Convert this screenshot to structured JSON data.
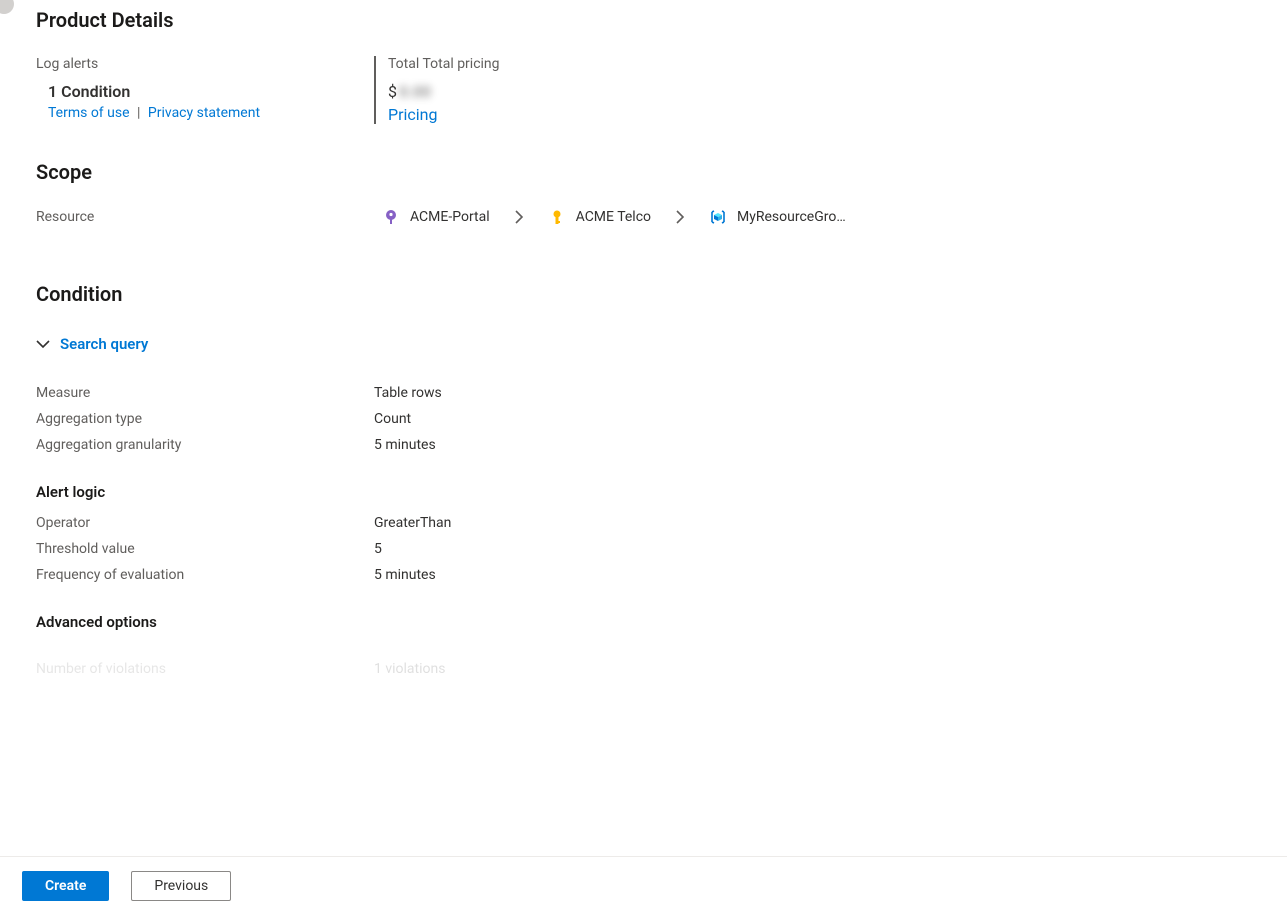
{
  "product": {
    "title": "Product Details",
    "left": {
      "label": "Log alerts",
      "condition_count": "1 Condition",
      "terms_link": "Terms of use",
      "privacy_link": "Privacy statement",
      "separator": "|"
    },
    "right": {
      "label": "Total Total pricing",
      "currency": "$",
      "blurred_value": "0.00",
      "pricing_link": "Pricing"
    }
  },
  "scope": {
    "title": "Scope",
    "label": "Resource",
    "crumbs": [
      "ACME-Portal",
      "ACME Telco",
      "MyResourceGro…"
    ]
  },
  "condition": {
    "title": "Condition",
    "search_query": "Search query",
    "rows": {
      "measure_key": "Measure",
      "measure_val": "Table rows",
      "aggtype_key": "Aggregation type",
      "aggtype_val": "Count",
      "agggran_key": "Aggregation granularity",
      "agggran_val": "5 minutes"
    },
    "alert_logic": {
      "title": "Alert logic",
      "operator_key": "Operator",
      "operator_val": "GreaterThan",
      "threshold_key": "Threshold value",
      "threshold_val": "5",
      "freq_key": "Frequency of evaluation",
      "freq_val": "5 minutes"
    },
    "advanced": {
      "title": "Advanced options",
      "numviol_key": "Number of violations",
      "numviol_val": "1 violations"
    }
  },
  "footer": {
    "create": "Create",
    "previous": "Previous"
  }
}
